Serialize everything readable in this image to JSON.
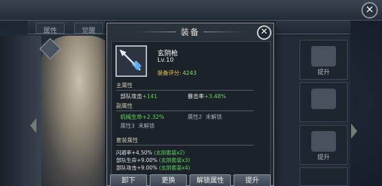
{
  "background": {
    "tabs": [
      "属性",
      "觉醒"
    ],
    "upgrade_label": "提升"
  },
  "popup": {
    "title": "装备",
    "item": {
      "name": "玄阴枪",
      "level": "Lv.10",
      "score_label": "装备评分:",
      "score_value": "4243"
    },
    "main_attr": {
      "header": "主属性",
      "rows": [
        {
          "label": "部队攻击",
          "value": "+141"
        },
        {
          "label": "暴击率",
          "value": "+3.48%"
        }
      ]
    },
    "sub_attr": {
      "header": "副属性",
      "rows": [
        {
          "label": "机械生命",
          "value": "+2.32%"
        },
        {
          "label": "属性2",
          "value": "未解锁"
        },
        {
          "label": "属性3",
          "value": "未解锁"
        }
      ]
    },
    "set_attr": {
      "header": "套装属性",
      "rows": [
        {
          "label": "闪避率",
          "value": "+4.50%",
          "note": "(玄阴套装x2)"
        },
        {
          "label": "部队生命",
          "value": "+9.00%",
          "note": "(玄阴套装x3)"
        },
        {
          "label": "部队攻击",
          "value": "+9.00%",
          "note": "(玄阴套装x4)"
        }
      ]
    },
    "buttons": {
      "unequip": "卸下",
      "replace": "更换",
      "unlock_attr": "解锁属性",
      "upgrade": "提升"
    }
  },
  "colors": {
    "accent_green": "#5ed85a",
    "score_gold": "#e7c54c"
  },
  "icons": [
    "close-icon",
    "spear-icon",
    "helmet-icon",
    "arrow-left-icon",
    "arrow-right-icon"
  ]
}
